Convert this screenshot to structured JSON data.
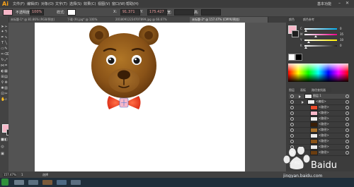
{
  "app": {
    "logo": "Ai",
    "workspace": "基本功能"
  },
  "menu": [
    "文件(F)",
    "编辑(E)",
    "对象(O)",
    "文字(T)",
    "选择(S)",
    "效果(C)",
    "视图(V)",
    "窗口(W)",
    "帮助(H)"
  ],
  "control_bar": {
    "mode": "不透明度",
    "opacity": "100%",
    "style_label": "样式:",
    "x_value": "91.371",
    "y_value": "175.427",
    "w_label": "宽:",
    "h_label": "高:"
  },
  "tabs": [
    {
      "label": "未标题-1* @ 81.86% (RGB/预览)",
      "active": false
    },
    {
      "label": "下载 (9).jpg* @ 100%",
      "active": false
    },
    {
      "label": "20180912234707899.jpg @ 66.67%",
      "active": false
    },
    {
      "label": "未标题-2* @ 157.47% (CMYK/预览)",
      "active": true
    }
  ],
  "panels": {
    "tabs": [
      "颜色",
      "颜色参考"
    ],
    "sliders": [
      {
        "label": "C",
        "value": "0",
        "color": "#00aeef"
      },
      {
        "label": "M",
        "value": "35",
        "color": "#ec008c"
      },
      {
        "label": "Y",
        "value": "10",
        "color": "#fff200"
      },
      {
        "label": "K",
        "value": "0",
        "color": "#222222"
      }
    ],
    "layers_tabs": [
      "图层",
      "画板",
      "路径查找器"
    ],
    "layers": [
      {
        "name": "图层 1"
      },
      {
        "name": "<编组>"
      },
      {
        "name": "<路径>"
      },
      {
        "name": "<路径>"
      },
      {
        "name": "<路径>"
      },
      {
        "name": "<路径>"
      },
      {
        "name": "<路径>"
      },
      {
        "name": "<路径>"
      },
      {
        "name": "<路径>"
      },
      {
        "name": "<路径>"
      },
      {
        "name": "<路径>"
      }
    ],
    "layers_count": "1 个图层"
  },
  "status": {
    "zoom": "157.47%",
    "page": "1",
    "tool_name": "选择"
  },
  "colors": {
    "fill": "#f7b7c8",
    "stroke": "#1e1e1e",
    "accent": "#f7a21b",
    "bear": "#8a5318",
    "bowtie": "#ee3b1f"
  },
  "watermark": {
    "text": "jingyan.baidu.com",
    "brand": "Baidu经验"
  },
  "taskbar": {
    "start_icon": "windows-start-icon"
  }
}
